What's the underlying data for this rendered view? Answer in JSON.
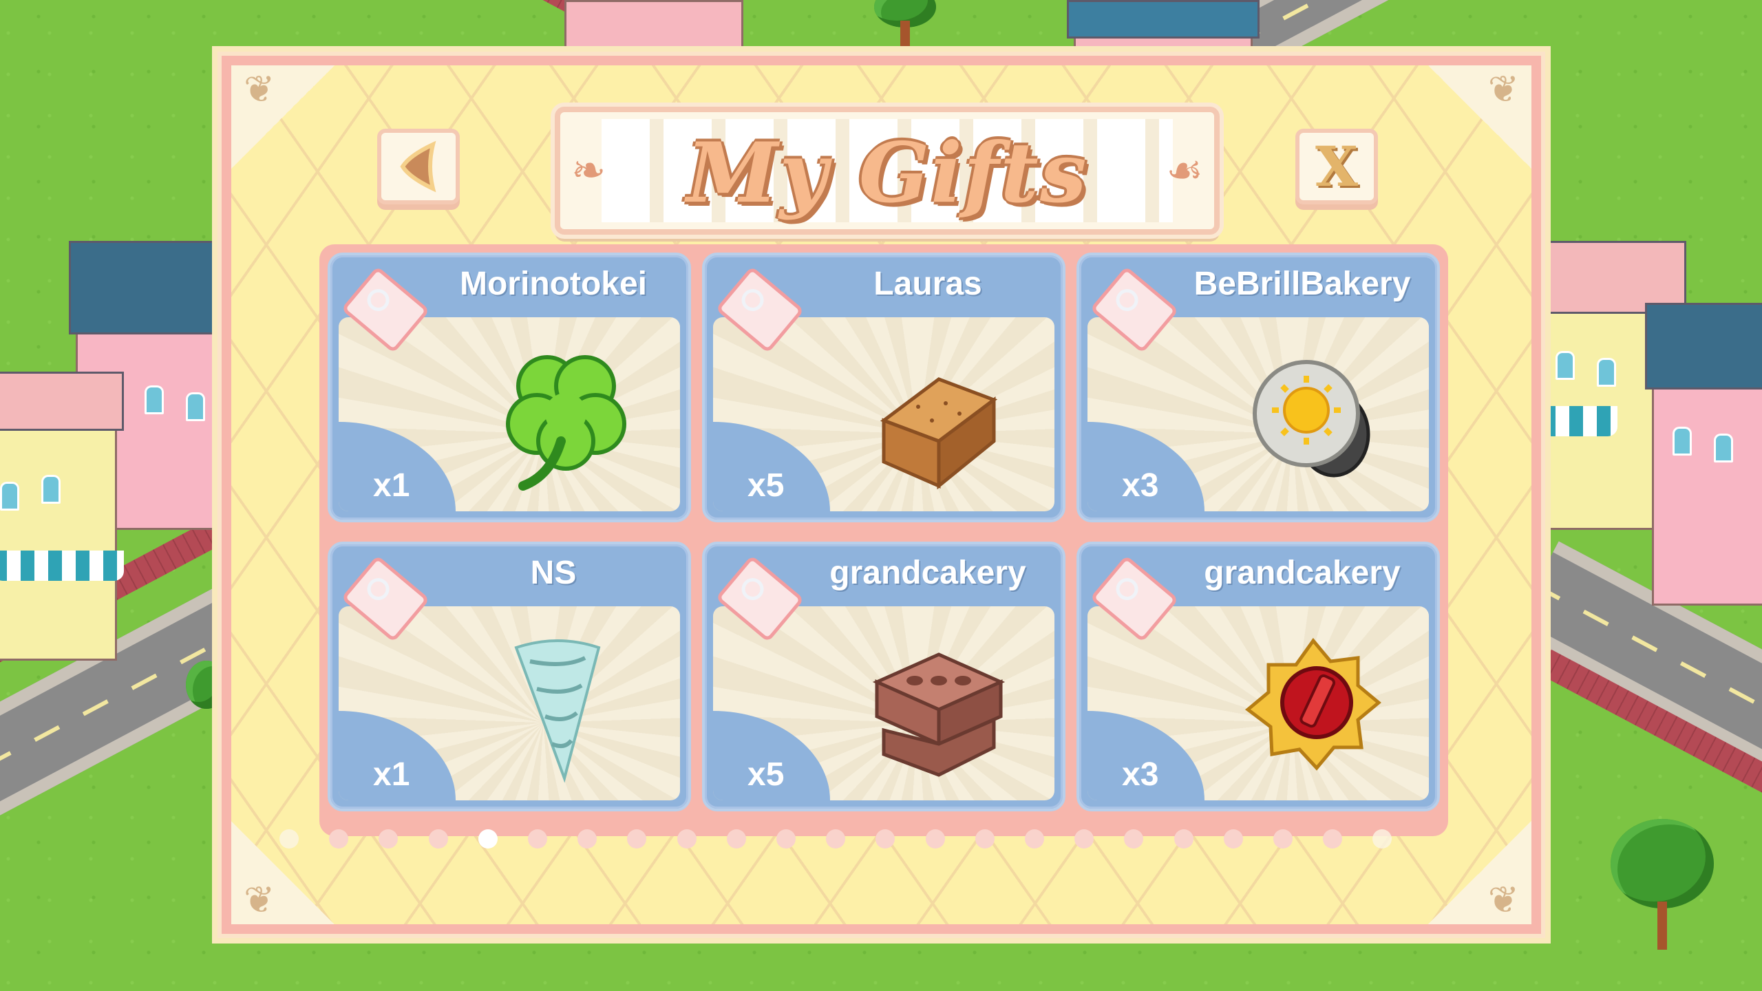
{
  "dialog": {
    "title": "My Gifts",
    "close_label": "X"
  },
  "gifts": [
    {
      "sender": "Morinotokei",
      "quantity": "x1",
      "item_icon": "four-leaf-clover-icon"
    },
    {
      "sender": "Lauras",
      "quantity": "x5",
      "item_icon": "brick-icon"
    },
    {
      "sender": "BeBrillBakery",
      "quantity": "x3",
      "item_icon": "oven-light-bulb-icon"
    },
    {
      "sender": "NS",
      "quantity": "x1",
      "item_icon": "drill-bit-icon"
    },
    {
      "sender": "grandcakery",
      "quantity": "x5",
      "item_icon": "red-bricks-icon"
    },
    {
      "sender": "grandcakery",
      "quantity": "x3",
      "item_icon": "oven-knob-icon"
    }
  ],
  "pagination": {
    "page_count": 23,
    "current_page": 5
  },
  "colors": {
    "grass": "#7cc443",
    "dialog_bg": "#fdf0a8",
    "dialog_border": "#f7b6ac",
    "card_blue": "#8fb3dc",
    "title_orange": "#f7b98c"
  }
}
